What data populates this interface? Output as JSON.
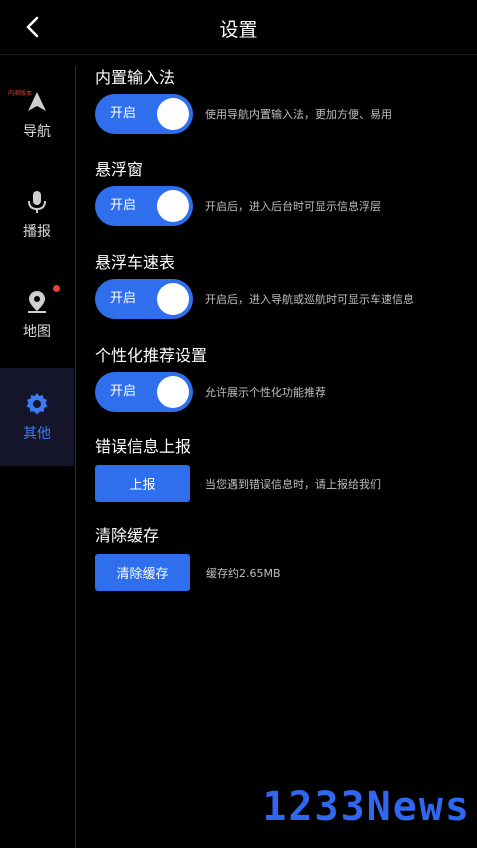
{
  "header": {
    "title": "设置"
  },
  "sidebar": {
    "items": [
      {
        "label": "导航",
        "icon": "navigation-arrow-icon"
      },
      {
        "label": "播报",
        "icon": "microphone-icon"
      },
      {
        "label": "地图",
        "icon": "map-pin-icon"
      },
      {
        "label": "其他",
        "icon": "gear-icon",
        "active": true
      }
    ],
    "tag_text": "内测版本"
  },
  "settings": {
    "input": {
      "title": "内置输入法",
      "toggle_label": "开启",
      "desc": "使用导航内置输入法，更加方便、易用"
    },
    "float": {
      "title": "悬浮窗",
      "toggle_label": "开启",
      "desc": "开启后，进入后台时可显示信息浮层"
    },
    "speed": {
      "title": "悬浮车速表",
      "toggle_label": "开启",
      "desc": "开启后，进入导航或巡航时可显示车速信息"
    },
    "personal": {
      "title": "个性化推荐设置",
      "toggle_label": "开启",
      "desc": "允许展示个性化功能推荐"
    },
    "report": {
      "title": "错误信息上报",
      "button_label": "上报",
      "desc": "当您遇到错误信息时，请上报给我们"
    },
    "cache": {
      "title": "清除缓存",
      "button_label": "清除缓存",
      "desc": "缓存约2.65MB"
    }
  },
  "watermark": "1233News",
  "colors": {
    "accent": "#2f6fed",
    "alert": "#e8423a"
  }
}
